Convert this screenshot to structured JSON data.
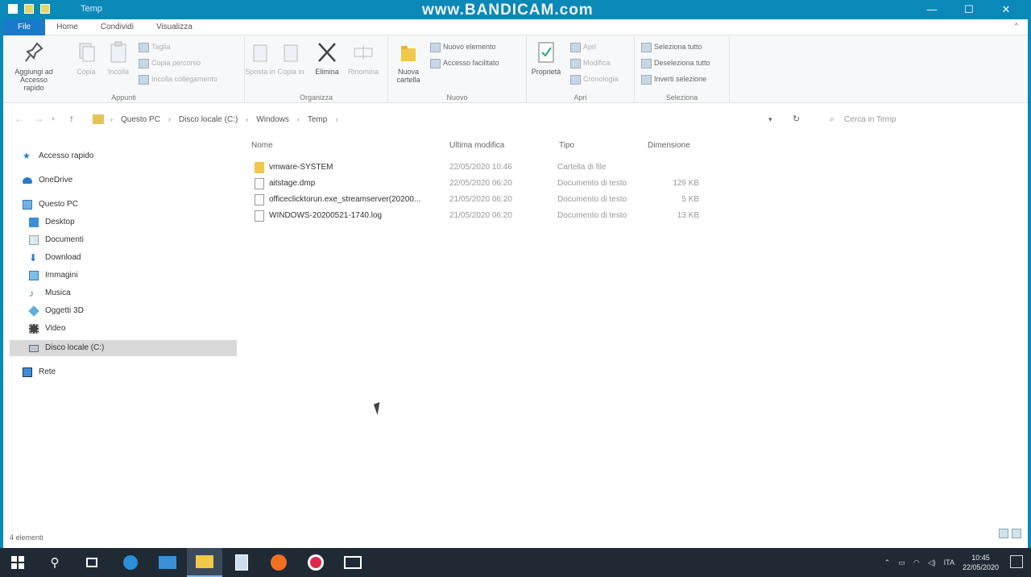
{
  "window": {
    "title": "Temp",
    "watermark": "www.BANDICAM.com",
    "controls": [
      "—",
      "☐",
      "✕"
    ]
  },
  "tabs": [
    "File",
    "Home",
    "Condividi",
    "Visualizza"
  ],
  "ribbon": {
    "appunti": {
      "label": "Appunti",
      "pin": "Aggiungi ad Accesso rapido",
      "copy": "Copia",
      "paste": "Incolla",
      "cut": "Taglia",
      "copy_path": "Copia percorso",
      "paste_shortcut": "Incolla collegamento"
    },
    "organizza": {
      "label": "Organizza",
      "move": "Sposta in",
      "copy_to": "Copia in",
      "delete": "Elimina",
      "rename": "Rinomina"
    },
    "nuovo": {
      "label": "Nuovo",
      "new_folder": "Nuova cartella",
      "new_item": "Nuovo elemento",
      "easy_access": "Accesso facilitato"
    },
    "apri": {
      "label": "Apri",
      "properties": "Proprietà",
      "open": "Apri",
      "edit": "Modifica",
      "history": "Cronologia"
    },
    "seleziona": {
      "label": "Seleziona",
      "select_all": "Seleziona tutto",
      "select_none": "Deseleziona tutto",
      "invert": "Inverti selezione"
    }
  },
  "address": {
    "crumbs": [
      "Questo PC",
      "Disco locale (C:)",
      "Windows",
      "Temp"
    ],
    "search_placeholder": "Cerca in Temp"
  },
  "nav": {
    "quick_access": "Accesso rapido",
    "onedrive": "OneDrive",
    "this_pc": "Questo PC",
    "items": [
      "Desktop",
      "Documenti",
      "Download",
      "Immagini",
      "Musica",
      "Oggetti 3D",
      "Video",
      "Disco locale (C:)"
    ],
    "network": "Rete"
  },
  "columns": {
    "name": "Nome",
    "modified": "Ultima modifica",
    "type": "Tipo",
    "size": "Dimensione"
  },
  "files": [
    {
      "name": "vmware-SYSTEM",
      "modified": "22/05/2020 10:46",
      "type": "Cartella di file",
      "size": "",
      "kind": "folder"
    },
    {
      "name": "aitstage.dmp",
      "modified": "22/05/2020 06:20",
      "type": "Documento di testo",
      "size": "129 KB",
      "kind": "file"
    },
    {
      "name": "officeclicktorun.exe_streamserver(20200...",
      "modified": "21/05/2020 06:20",
      "type": "Documento di testo",
      "size": "5 KB",
      "kind": "file"
    },
    {
      "name": "WINDOWS-20200521-1740.log",
      "modified": "21/05/2020 06:20",
      "type": "Documento di testo",
      "size": "13 KB",
      "kind": "file"
    }
  ],
  "status": "4 elementi",
  "taskbar": {
    "time": "10:45",
    "date": "22/05/2020",
    "lang": "ITA"
  }
}
